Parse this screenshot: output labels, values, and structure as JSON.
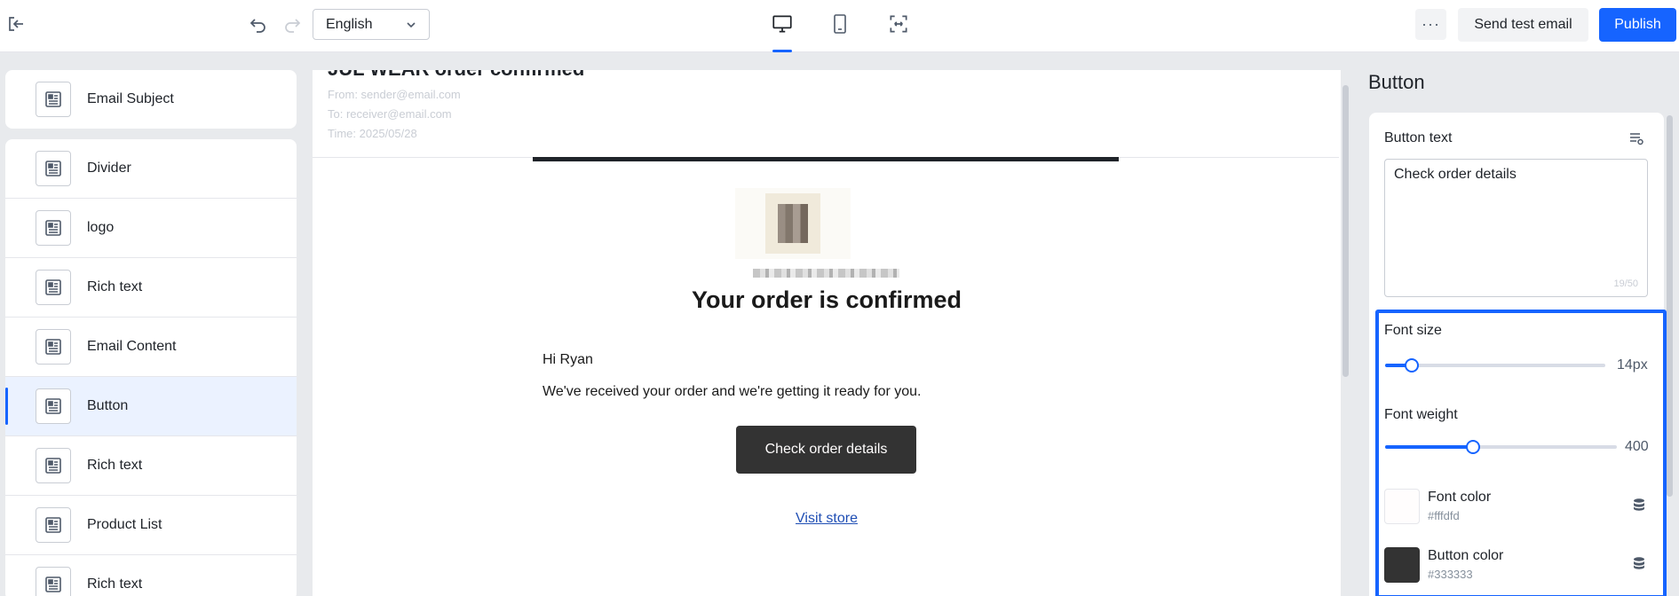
{
  "toolbar": {
    "language": "English",
    "send_test_label": "Send test email",
    "publish_label": "Publish",
    "more_label": "···"
  },
  "left_panel": {
    "subject_item": "Email Subject",
    "items": [
      {
        "label": "Divider"
      },
      {
        "label": "logo"
      },
      {
        "label": "Rich text"
      },
      {
        "label": "Email Content"
      },
      {
        "label": "Button",
        "selected": true
      },
      {
        "label": "Rich text"
      },
      {
        "label": "Product List"
      },
      {
        "label": "Rich text"
      }
    ]
  },
  "preview": {
    "subject": "JUL WEAR order confirmed",
    "from": "From: sender@email.com",
    "to": "To: receiver@email.com",
    "time": "Time: 2025/05/28",
    "headline": "Your order is confirmed",
    "greeting": "Hi Ryan",
    "body": "We've received your order and we're getting it ready for you.",
    "cta_label": "Check order details",
    "visit_label": "Visit store"
  },
  "properties": {
    "title": "Button",
    "button_text_label": "Button text",
    "button_text_value": "Check order details",
    "char_count": "19/50",
    "font_size_label": "Font size",
    "font_size_value": "14px",
    "font_size_fraction": 0.12,
    "font_weight_label": "Font weight",
    "font_weight_value": "400",
    "font_weight_fraction": 0.38,
    "font_color_label": "Font color",
    "font_color_hex": "#fffdfd",
    "button_color_label": "Button color",
    "button_color_hex": "#333333"
  },
  "colors": {
    "accent": "#1664ff",
    "button_bg": "#333333",
    "link": "#1f4eb4"
  },
  "icons": {
    "exit": "exit-icon",
    "undo": "undo-icon",
    "redo": "redo-icon",
    "desktop": "desktop-icon",
    "tablet": "tablet-icon",
    "fullscreen": "fullscreen-icon",
    "block": "block-icon",
    "database": "database-icon"
  }
}
